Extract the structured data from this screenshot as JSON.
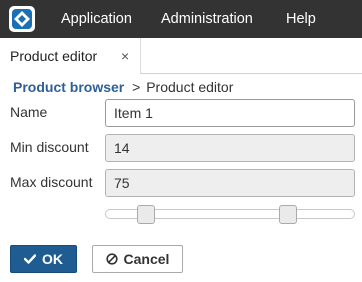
{
  "menu": {
    "logo": "app-logo",
    "items": [
      "Application",
      "Administration",
      "Help"
    ]
  },
  "tabs": [
    {
      "label": "Product editor",
      "close": "×"
    }
  ],
  "breadcrumb": {
    "link": "Product browser",
    "separator": ">",
    "current": "Product editor"
  },
  "form": {
    "name": {
      "label": "Name",
      "value": "Item 1"
    },
    "min_discount": {
      "label": "Min discount",
      "value": "14"
    },
    "max_discount": {
      "label": "Max discount",
      "value": "75"
    },
    "slider": {
      "min_value": 14,
      "max_value": 75
    }
  },
  "buttons": {
    "ok": {
      "label": "OK",
      "icon": "check-icon"
    },
    "cancel": {
      "label": "Cancel",
      "icon": "cancel-icon"
    }
  },
  "colors": {
    "topbar": "#333333",
    "accent": "#1f5c92",
    "link": "#2d5f99"
  }
}
